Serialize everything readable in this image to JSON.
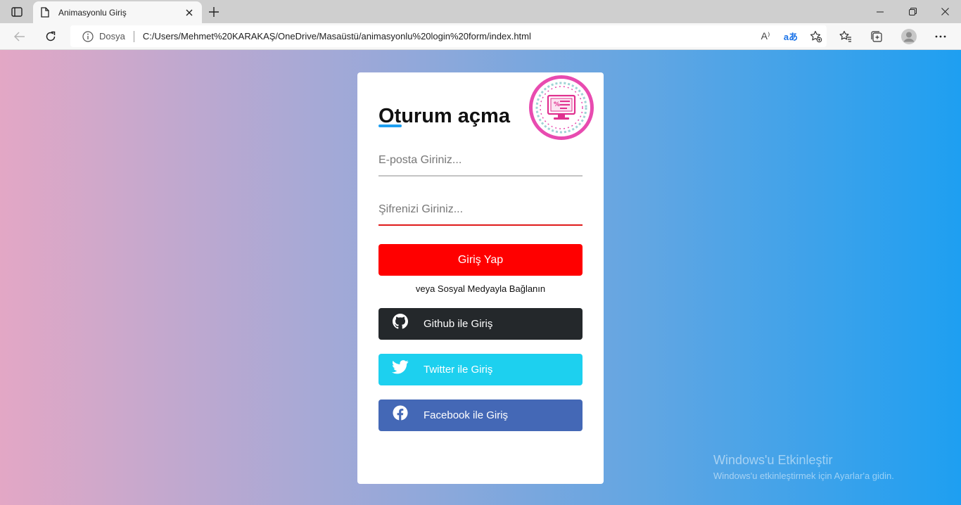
{
  "browser": {
    "tab_title": "Animasyonlu Giriş",
    "site_label": "Dosya",
    "url": "C:/Users/Mehmet%20KARAKAŞ/OneDrive/Masaüstü/animasyonlu%20login%20form/index.html",
    "read_aloud_glyph": "A⁾",
    "translate_glyph": "aあ",
    "icons": [
      "tab-actions-icon",
      "page-icon",
      "close-icon",
      "plus-icon",
      "minimize-icon",
      "restore-icon",
      "close-icon",
      "back-arrow-icon",
      "refresh-icon",
      "info-icon",
      "read-aloud-icon",
      "translate-icon",
      "add-favorite-icon",
      "favorites-icon",
      "collections-icon",
      "profile-icon",
      "more-icon"
    ]
  },
  "login": {
    "title": "Oturum açma",
    "email_placeholder": "E-posta Giriniz...",
    "password_placeholder": "Şifrenizi Giriniz...",
    "login_button": "Giriş Yap",
    "social_text": "veya Sosyal Medyayla Bağlanın",
    "github_label": "Github ile Giriş",
    "twitter_label": "Twitter ile Giriş",
    "facebook_label": "Facebook ile Giriş"
  },
  "watermark": {
    "line1": "Windows'u Etkinleştir",
    "line2": "Windows'u etkinleştirmek için Ayarlar'a gidin."
  },
  "colors": {
    "login_button": "#ff0000",
    "github": "#24282b",
    "twitter": "#1dd0ef",
    "facebook": "#4468b6",
    "accent": "#1e9ff1",
    "logo_ring": "#e84bb0"
  }
}
